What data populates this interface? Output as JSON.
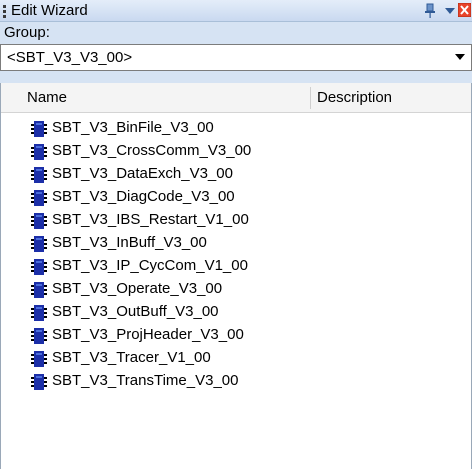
{
  "window": {
    "title": "Edit Wizard",
    "icons": [
      "grip-icon",
      "pin-icon",
      "dropdown-icon",
      "close-icon"
    ],
    "colors": {
      "header": "#c9d9f0",
      "group_bar": "#d6e3f3",
      "close": "#e8442a",
      "item_icon": "#1c2fa8"
    }
  },
  "group": {
    "label": "Group:",
    "selected": "<SBT_V3_V3_00>"
  },
  "list": {
    "columns": [
      "Name",
      "Description"
    ],
    "items": [
      "SBT_V3_BinFile_V3_00",
      "SBT_V3_CrossComm_V3_00",
      "SBT_V3_DataExch_V3_00",
      "SBT_V3_DiagCode_V3_00",
      "SBT_V3_IBS_Restart_V1_00",
      "SBT_V3_InBuff_V3_00",
      "SBT_V3_IP_CycCom_V1_00",
      "SBT_V3_Operate_V3_00",
      "SBT_V3_OutBuff_V3_00",
      "SBT_V3_ProjHeader_V3_00",
      "SBT_V3_Tracer_V1_00",
      "SBT_V3_TransTime_V3_00"
    ]
  }
}
